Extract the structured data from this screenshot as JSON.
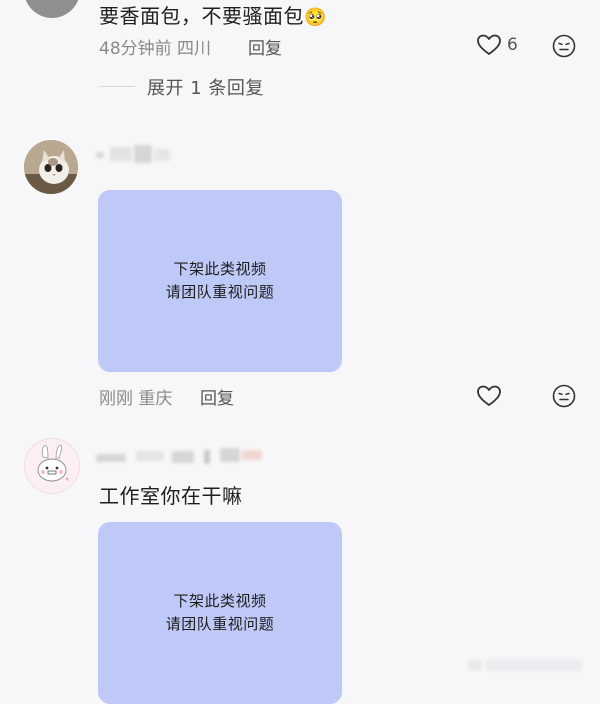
{
  "top_comment": {
    "text": "要香面包，不要骚面包",
    "emoji": "🥺",
    "meta": "48分钟前 四川",
    "reply_label": "回复",
    "like_count": "6"
  },
  "expand": {
    "label": "展开 1 条回复"
  },
  "comment_cat": {
    "card_line1": "下架此类视频",
    "card_line2": "请团队重视问题",
    "meta": "刚刚 重庆",
    "reply_label": "回复"
  },
  "comment_bunny": {
    "text": "工作室你在干嘛",
    "card_line1": "下架此类视频",
    "card_line2": "请团队重视问题"
  },
  "colors": {
    "card": "#bec9f7",
    "background": "#f7f7f9",
    "meta": "#8a8a8a"
  }
}
